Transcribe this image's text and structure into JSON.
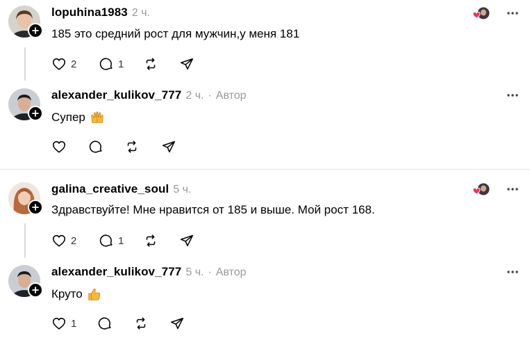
{
  "comments": [
    {
      "username": "lopuhina1983",
      "time": "2 ч.",
      "author_label": "",
      "text": "185 это средний рост для мужчин,у меня 181",
      "emoji": "",
      "likes": "2",
      "replies": "1",
      "avatar": "woman-dark-hair"
    },
    {
      "username": "alexander_kulikov_777",
      "time": "2 ч.",
      "author_label": "Автор",
      "text": "Супер",
      "emoji": "raised-hands",
      "likes": "",
      "replies": "",
      "avatar": "man-dark-hair"
    },
    {
      "username": "galina_creative_soul",
      "time": "5 ч.",
      "author_label": "",
      "text": "Здравствуйте! Мне нравится от 185 и выше. Мой рост 168.",
      "emoji": "",
      "likes": "2",
      "replies": "1",
      "avatar": "woman-red-hair"
    },
    {
      "username": "alexander_kulikov_777",
      "time": "5 ч.",
      "author_label": "Автор",
      "text": "Круто",
      "emoji": "thumbs-up",
      "likes": "1",
      "replies": "",
      "avatar": "man-dark-hair"
    }
  ],
  "separator": "·",
  "colors": {
    "heart": "#ff2a55",
    "muted": "#999999",
    "thread": "#d9d9d9"
  }
}
